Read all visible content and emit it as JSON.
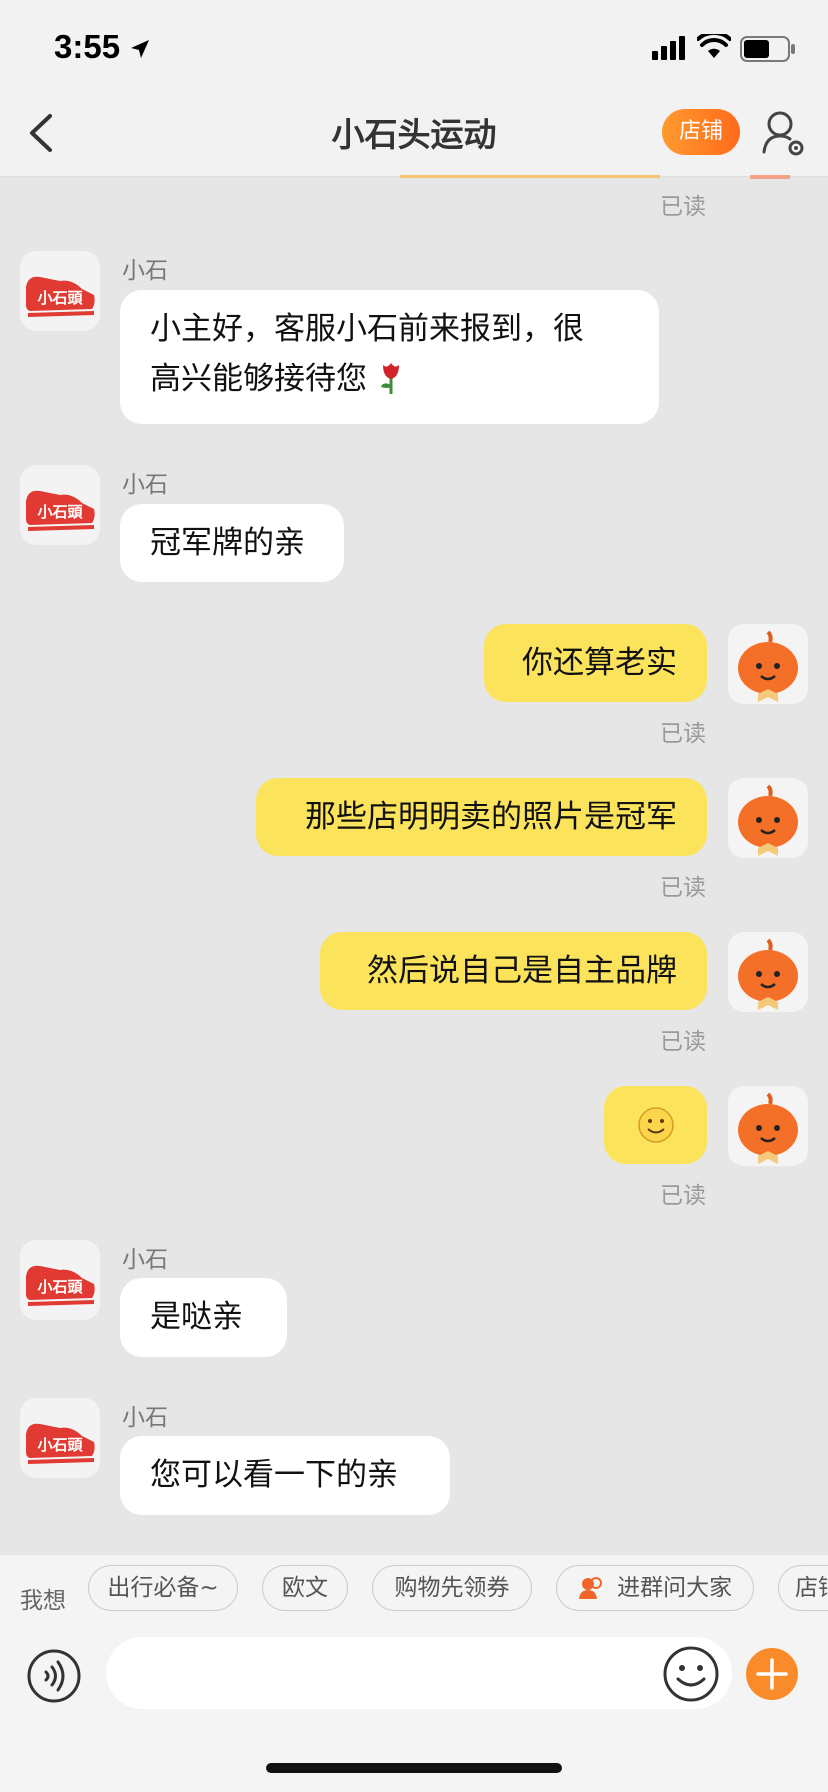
{
  "status": {
    "time": "3:55"
  },
  "nav": {
    "title": "小石头运动",
    "shop_label": "店铺"
  },
  "read_label": "已读",
  "messages": [
    {
      "sender": "小石",
      "text_line1": "小主好，客服小石前来报到，很",
      "text_line2": "高兴能够接待您"
    },
    {
      "sender": "小石",
      "text": "冠军牌的亲"
    },
    {
      "text": "你还算老实",
      "status": "已读"
    },
    {
      "text": "那些店明明卖的照片是冠军",
      "status": "已读"
    },
    {
      "text": "然后说自己是自主品牌",
      "status": "已读"
    },
    {
      "emoji": "🙂",
      "status": "已读"
    },
    {
      "sender": "小石",
      "text": "是哒亲"
    },
    {
      "sender": "小石",
      "text": "您可以看一下的亲"
    }
  ],
  "suggestions": {
    "label": "我想",
    "chips": [
      "出行必备~",
      "欧文",
      "购物先领券",
      "进群问大家",
      "店铺"
    ]
  },
  "colors": {
    "accent": "#ff7a1f",
    "bubble_out": "#fbe35c",
    "bubble_in": "#ffffff",
    "background": "#e6e6e6"
  },
  "icons": [
    "back-chevron-icon",
    "profile-settings-icon",
    "voice-icon",
    "emoji-icon",
    "plus-icon",
    "rose-icon",
    "group-icon"
  ]
}
